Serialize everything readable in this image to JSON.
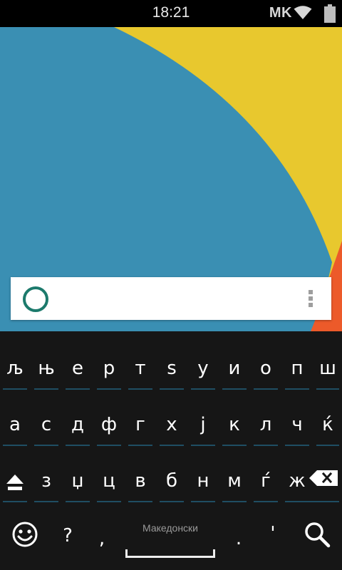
{
  "status_bar": {
    "time": "18:21",
    "locale": "MK",
    "icons": [
      "wifi-icon",
      "battery-icon"
    ]
  },
  "wallpaper": {
    "colors": {
      "blue": "#3a8fb3",
      "yellow": "#e8c82e",
      "orange": "#ec5a2a"
    }
  },
  "search_widget": {
    "icons": [
      "google-circle-icon",
      "overflow-menu-icon"
    ],
    "accent": "#1c7a6c"
  },
  "keyboard": {
    "row1": [
      "љ",
      "њ",
      "е",
      "р",
      "т",
      "ѕ",
      "у",
      "и",
      "о",
      "п",
      "ш"
    ],
    "row2": [
      "а",
      "с",
      "д",
      "ф",
      "г",
      "х",
      "ј",
      "к",
      "л",
      "ч",
      "ќ"
    ],
    "row3": [
      "з",
      "џ",
      "ц",
      "в",
      "б",
      "н",
      "м",
      "ѓ",
      "ж"
    ],
    "bottom": {
      "question": "?",
      "comma": ",",
      "space_label": "Македонски",
      "period": ".",
      "apostrophe": "'"
    },
    "icons": [
      "shift-icon",
      "backspace-icon",
      "emoji-icon",
      "search-icon"
    ],
    "underline_color": "#1f4e63"
  }
}
